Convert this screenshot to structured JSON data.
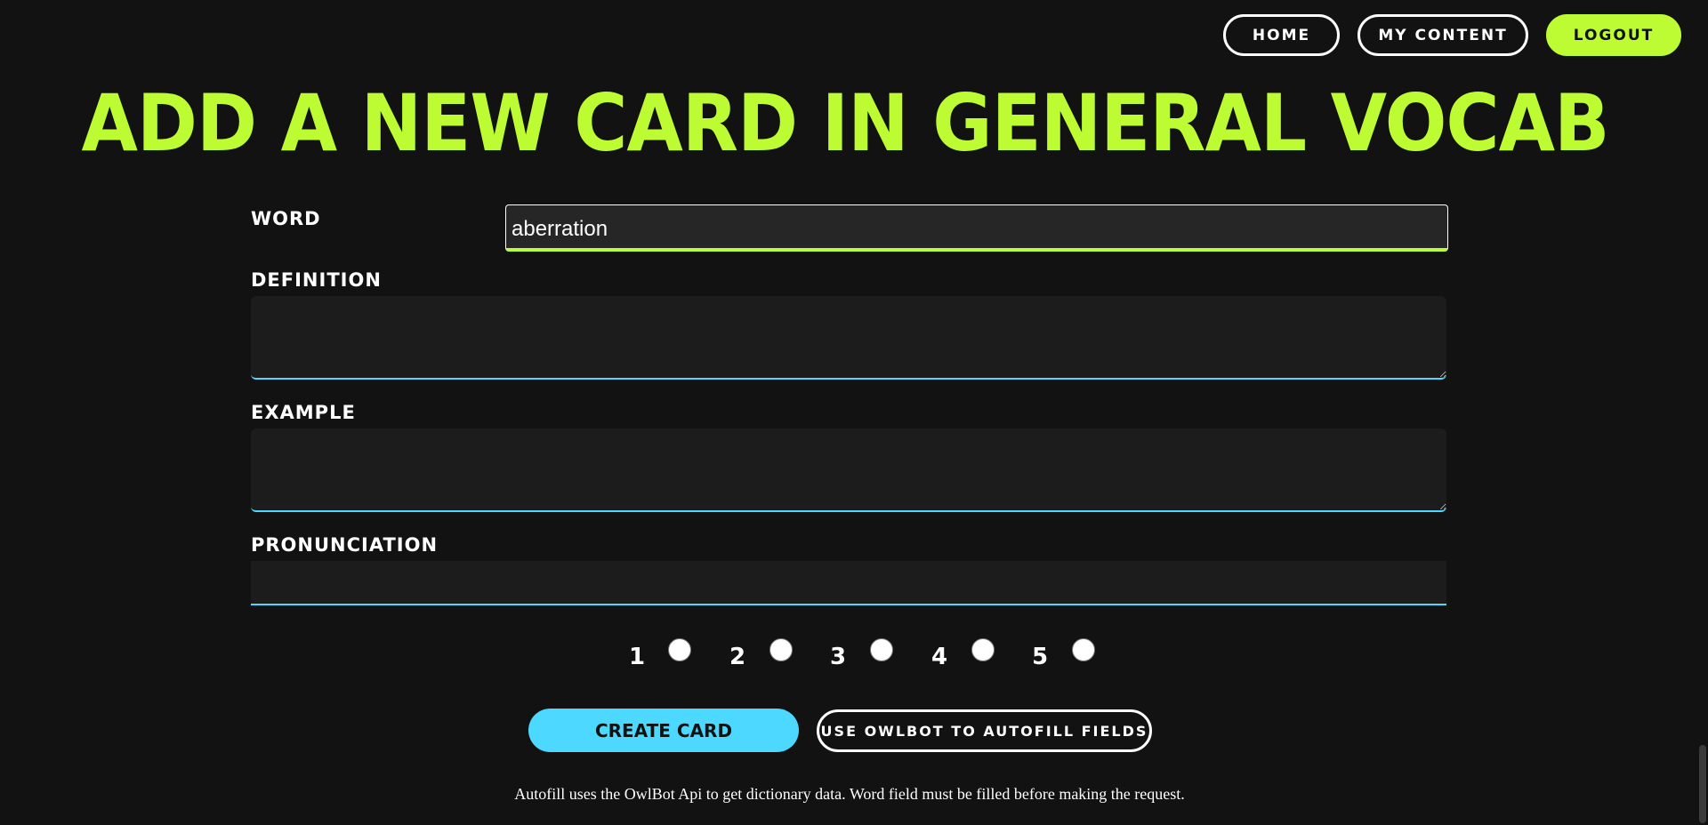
{
  "nav": {
    "home": "HOME",
    "my_content": "MY CONTENT",
    "logout": "LOGOUT"
  },
  "title": "ADD A NEW CARD IN GENERAL VOCAB",
  "form": {
    "word_label": "WORD",
    "word_value": "aberration",
    "definition_label": "DEFINITION",
    "definition_value": "",
    "example_label": "EXAMPLE",
    "example_value": "",
    "pronunciation_label": "PRONUNCIATION",
    "pronunciation_value": ""
  },
  "rating": {
    "options": [
      "1",
      "2",
      "3",
      "4",
      "5"
    ]
  },
  "actions": {
    "create": "CREATE CARD",
    "autofill": "USE OWLBOT TO AUTOFILL FIELDS"
  },
  "note": "Autofill uses the OwlBot Api to get dictionary data. Word field must be filled before making the request.",
  "colors": {
    "background": "#121212",
    "accent_green": "#bdfc32",
    "accent_blue": "#4dd9ff"
  }
}
